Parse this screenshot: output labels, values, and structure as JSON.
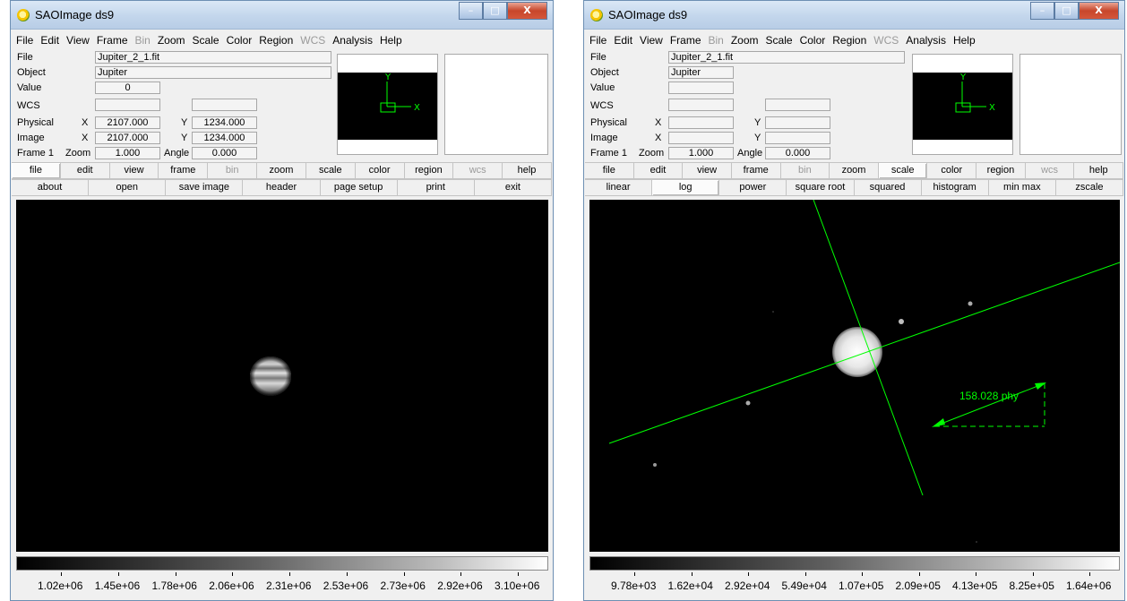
{
  "window_title": "SAOImage ds9",
  "window_controls": {
    "minimize": "–",
    "maximize": "□",
    "close": "X"
  },
  "menu": [
    "File",
    "Edit",
    "View",
    "Frame",
    "Bin",
    "Zoom",
    "Scale",
    "Color",
    "Region",
    "WCS",
    "Analysis",
    "Help"
  ],
  "menu_disabled": [
    "Bin",
    "WCS"
  ],
  "labels": {
    "file": "File",
    "object": "Object",
    "value": "Value",
    "wcs": "WCS",
    "physical": "Physical",
    "image": "Image",
    "frame": "Frame 1",
    "x": "X",
    "y": "Y",
    "zoom": "Zoom",
    "angle": "Angle"
  },
  "panner_labels": {
    "x_axis": "X",
    "y_axis": "Y"
  },
  "colors": {
    "region_green": "#00ff00",
    "disabled_text": "#9a9a9a"
  },
  "left": {
    "info": {
      "file": "Jupiter_2_1.fit",
      "object": "Jupiter",
      "value": "0",
      "wcs_1": "",
      "wcs_2": "",
      "physical_x": "2107.000",
      "physical_y": "1234.000",
      "image_x": "2107.000",
      "image_y": "1234.000",
      "zoom": "1.000",
      "angle": "0.000"
    },
    "main_buttons": [
      {
        "label": "file",
        "selected": true
      },
      {
        "label": "edit"
      },
      {
        "label": "view"
      },
      {
        "label": "frame"
      },
      {
        "label": "bin",
        "disabled": true
      },
      {
        "label": "zoom"
      },
      {
        "label": "scale"
      },
      {
        "label": "color"
      },
      {
        "label": "region"
      },
      {
        "label": "wcs",
        "disabled": true
      },
      {
        "label": "help"
      }
    ],
    "sub_buttons": [
      {
        "label": "about"
      },
      {
        "label": "open"
      },
      {
        "label": "save image"
      },
      {
        "label": "header"
      },
      {
        "label": "page setup"
      },
      {
        "label": "print"
      },
      {
        "label": "exit"
      }
    ],
    "colorbar_ticks": [
      "1.02e+06",
      "1.45e+06",
      "1.78e+06",
      "2.06e+06",
      "2.31e+06",
      "2.53e+06",
      "2.73e+06",
      "2.92e+06",
      "3.10e+06"
    ]
  },
  "right": {
    "info": {
      "file": "Jupiter_2_1.fit",
      "object": "Jupiter",
      "value": "",
      "wcs_1": "",
      "wcs_2": "",
      "physical_x": "",
      "physical_y": "",
      "image_x": "",
      "image_y": "",
      "zoom": "1.000",
      "angle": "0.000"
    },
    "main_buttons": [
      {
        "label": "file"
      },
      {
        "label": "edit"
      },
      {
        "label": "view"
      },
      {
        "label": "frame"
      },
      {
        "label": "bin",
        "disabled": true
      },
      {
        "label": "zoom"
      },
      {
        "label": "scale",
        "selected": true
      },
      {
        "label": "color"
      },
      {
        "label": "region"
      },
      {
        "label": "wcs",
        "disabled": true
      },
      {
        "label": "help"
      }
    ],
    "sub_buttons": [
      {
        "label": "linear"
      },
      {
        "label": "log",
        "selected": true
      },
      {
        "label": "power"
      },
      {
        "label": "square root"
      },
      {
        "label": "squared"
      },
      {
        "label": "histogram"
      },
      {
        "label": "min max"
      },
      {
        "label": "zscale"
      }
    ],
    "ruler_label": "158.028 phy",
    "colorbar_ticks": [
      "9.78e+03",
      "1.62e+04",
      "2.92e+04",
      "5.49e+04",
      "1.07e+05",
      "2.09e+05",
      "4.13e+05",
      "8.25e+05",
      "1.64e+06"
    ]
  }
}
